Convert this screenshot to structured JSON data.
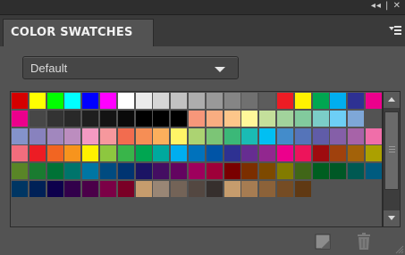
{
  "window": {
    "controls": "◂◂ | ✕"
  },
  "panel": {
    "title": "COLOR SWATCHES"
  },
  "library": {
    "selected": "Default"
  },
  "swatches": [
    [
      "#d50000",
      "#ffff00",
      "#00ff00",
      "#00ffff",
      "#0000ff",
      "#ff00ff",
      "#ffffff",
      "#ebebeb",
      "#d6d6d6",
      "#c2c2c2",
      "#adadad",
      "#999999",
      "#858585",
      "#707070",
      "#5c5c5c",
      "#ed1c24",
      "#fff200",
      "#00a651",
      "#00aeef",
      "#2e3192",
      "#ec008c"
    ],
    [
      "#ec008c",
      "#474747",
      "#333333",
      "#292929",
      "#1f1f1f",
      "#141414",
      "#0a0a0a",
      "#000000",
      "#000000",
      "#000000",
      "#f7977a",
      "#f9ad81",
      "#fdc68a",
      "#fff79a",
      "#c4df9b",
      "#a2d39c",
      "#82ca9d",
      "#7bcdc8",
      "#6dcff6",
      "#7ea7d8"
    ],
    [
      "#8493ca",
      "#8882be",
      "#a187be",
      "#bc8dbf",
      "#f49ac2",
      "#f6989d",
      "#f26c4f",
      "#f68e55",
      "#fbaf5c",
      "#fff467",
      "#acd372",
      "#7cc576",
      "#3bb878",
      "#1abbb4",
      "#00bff3",
      "#438ccb",
      "#5574b9",
      "#605ca8",
      "#855fa8",
      "#a763a8",
      "#f06ea9"
    ],
    [
      "#f26d7d",
      "#ed1c24",
      "#f26522",
      "#f7941d",
      "#fff200",
      "#8dc73f",
      "#39b54a",
      "#00a651",
      "#00a99d",
      "#00aeef",
      "#0072bc",
      "#0054a6",
      "#2e3192",
      "#662d91",
      "#92278f",
      "#ec008c",
      "#ed145b",
      "#9e0b0f",
      "#a0410d",
      "#a36209",
      "#aba000"
    ],
    [
      "#598527",
      "#1a7b30",
      "#007236",
      "#00746b",
      "#0076a3",
      "#004b80",
      "#003471",
      "#1b1464",
      "#440e62",
      "#630460",
      "#9e005d",
      "#9e0039",
      "#790000",
      "#7b2e00",
      "#7d4900",
      "#827b00",
      "#406618",
      "#005e20",
      "#005826",
      "#005952",
      "#005b7f"
    ],
    [
      "#003663",
      "#002157",
      "#0d004c",
      "#32004b",
      "#4b0049",
      "#7b0046",
      "#7a0026",
      "#c69c6d",
      "#998675",
      "#736357",
      "#534741",
      "#362f2d",
      "#c69c6d",
      "#a67c52",
      "#8c6239",
      "#754c24",
      "#603913"
    ]
  ],
  "colors": {
    "panel_bg": "#535353",
    "tab_bar_bg": "#3a3a3a",
    "title_text": "#f2f2f2",
    "dropdown_bg": "#464646"
  },
  "icons": {
    "menu": "panel-menu-icon",
    "new": "new-swatch-icon",
    "delete": "trash-icon",
    "resize": "resize-grip-icon"
  }
}
